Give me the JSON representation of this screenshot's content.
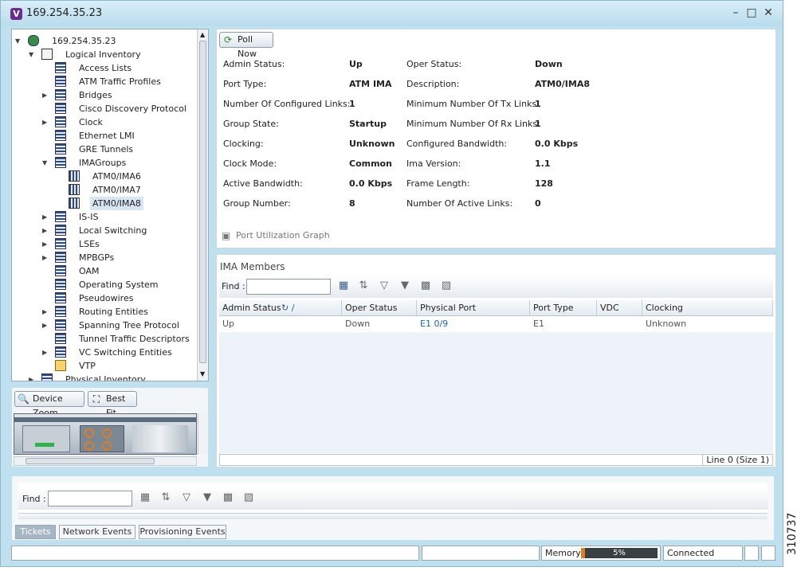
{
  "window": {
    "title": "169.254.35.23",
    "app_icon_letter": "V"
  },
  "tree": {
    "root": "169.254.35.23",
    "logical_inventory": "Logical Inventory",
    "items": [
      "Access Lists",
      "ATM Traffic Profiles",
      "Bridges",
      "Cisco Discovery Protocol",
      "Clock",
      "Ethernet LMI",
      "GRE Tunnels",
      "IMAGroups"
    ],
    "ima_children": [
      "ATM0/IMA6",
      "ATM0/IMA7",
      "ATM0/IMA8"
    ],
    "items_after": [
      "IS-IS",
      "Local Switching",
      "LSEs",
      "MPBGPs",
      "OAM",
      "Operating System",
      "Pseudowires",
      "Routing Entities",
      "Spanning Tree Protocol",
      "Tunnel Traffic Descriptors",
      "VC Switching Entities",
      "VTP"
    ],
    "physical_inventory": "Physical Inventory"
  },
  "device_view": {
    "zoom_label": "Device Zoom",
    "best_fit_label": "Best Fit"
  },
  "details": {
    "poll_now": "Poll Now",
    "left_labels": [
      "Admin Status:",
      "Port Type:",
      "Number Of Configured Links:",
      "Group State:",
      "Clocking:",
      "Clock Mode:",
      "Active Bandwidth:",
      "Group Number:"
    ],
    "left_values": [
      "Up",
      "ATM IMA",
      "1",
      "Startup",
      "Unknown",
      "Common",
      "0.0 Kbps",
      "8"
    ],
    "right_labels": [
      "Oper Status:",
      "Description:",
      "Minimum Number Of Tx Links:",
      "Minimum Number Of Rx Links:",
      "Configured Bandwidth:",
      "Ima Version:",
      "Frame Length:",
      "Number Of Active Links:"
    ],
    "right_values": [
      "Down",
      "ATM0/IMA8",
      "1",
      "1",
      "0.0 Kbps",
      "1.1",
      "128",
      "0"
    ],
    "port_graph": "Port Utilization Graph"
  },
  "ima_members": {
    "title": "IMA Members",
    "find_label": "Find :",
    "columns": [
      "Admin Status",
      "Oper Status",
      "Physical Port",
      "Port Type",
      "VDC",
      "Clocking"
    ],
    "rows": [
      {
        "admin": "Up",
        "oper": "Down",
        "port": "E1 0/9",
        "type": "E1",
        "vdc": "",
        "clocking": "Unknown"
      }
    ],
    "line_info": "Line 0 (Size 1)"
  },
  "bottom": {
    "find_label": "Find :",
    "tabs": [
      "Tickets",
      "Network Events",
      "Provisioning Events"
    ]
  },
  "status": {
    "memory_label": "Memory:",
    "memory_value": "5%",
    "memory_fraction": 0.05,
    "connection": "Connected"
  },
  "figure_id": "310737"
}
